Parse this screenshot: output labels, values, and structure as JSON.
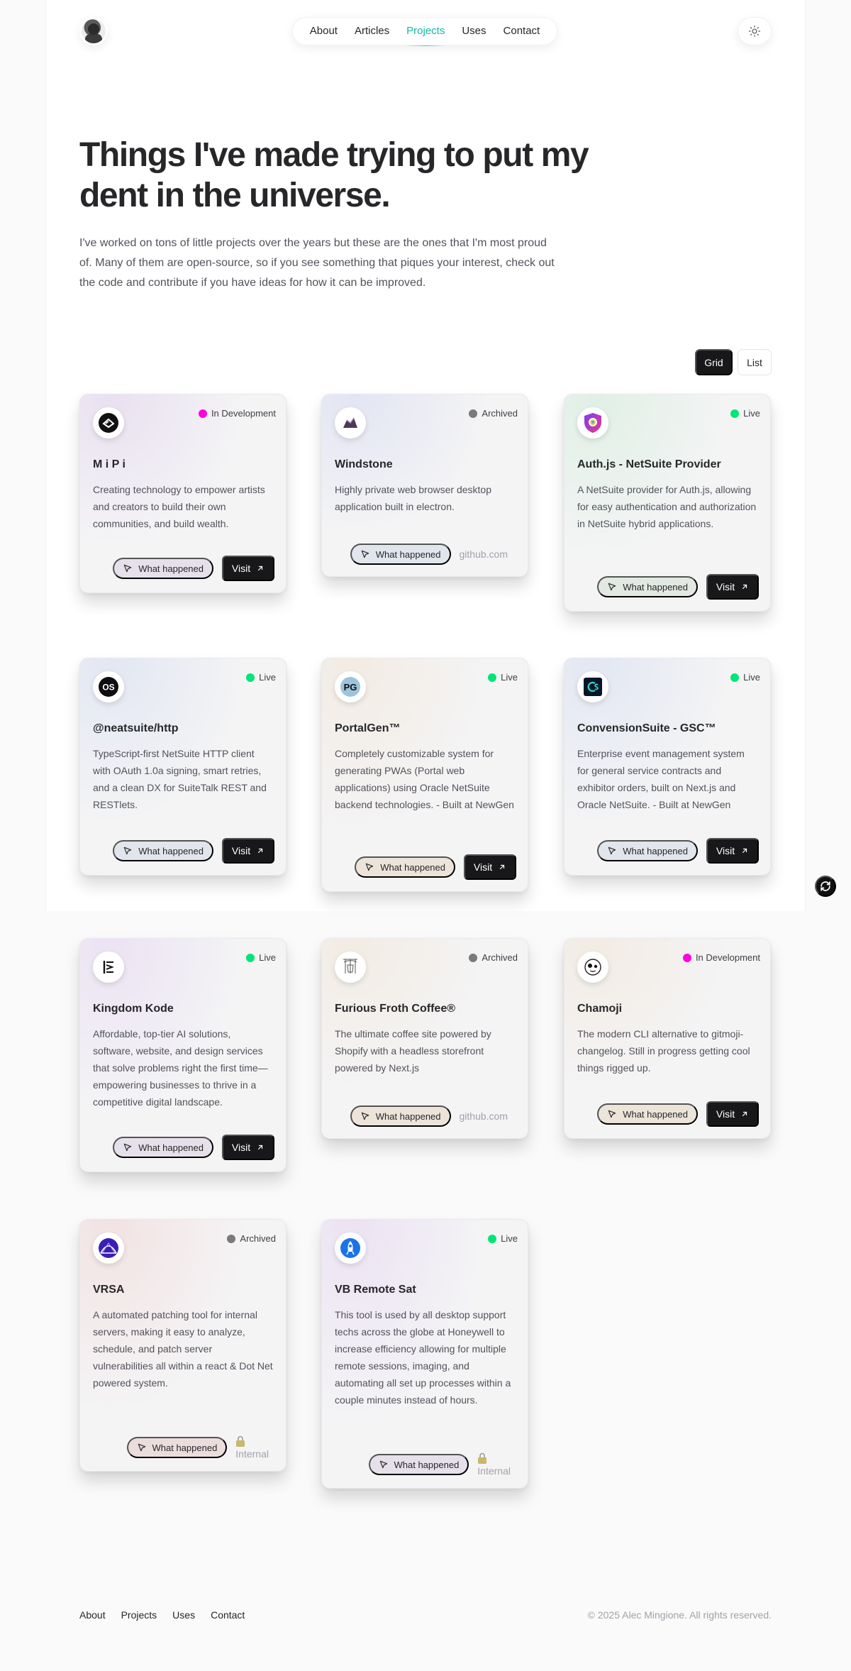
{
  "header": {
    "nav": [
      "About",
      "Articles",
      "Projects",
      "Uses",
      "Contact"
    ],
    "active_nav": "Projects"
  },
  "hero": {
    "title": "Things I've made trying to put my dent in the universe.",
    "subtitle": "I've worked on tons of little projects over the years but these are the ones that I'm most proud of. Many of them are open-source, so if you see something that piques your interest, check out the code and contribute if you have ideas for how it can be improved."
  },
  "view_toggle": {
    "grid": "Grid",
    "list": "List",
    "selected": "Grid"
  },
  "common": {
    "what_happened": "What happened",
    "visit": "Visit"
  },
  "colors": {
    "accent": "#14b8a6",
    "live": "#00e676",
    "archived": "#7a7a7a",
    "in_development": "#ff00e0"
  },
  "projects": [
    {
      "title": "M i P i",
      "status": "In Development",
      "description": "Creating technology to empower artists and creators to build their own communities, and build wealth.",
      "action": "visit",
      "logo_icon": "mipi-logo-icon"
    },
    {
      "title": "Windstone",
      "status": "Archived",
      "description": "Highly private web browser desktop application built in electron.",
      "action": "github",
      "action_label": "github.com",
      "logo_icon": "windstone-logo-icon"
    },
    {
      "title": "Auth.js - NetSuite Provider",
      "status": "Live",
      "description": "A NetSuite provider for Auth.js, allowing for easy authentication and authorization in NetSuite hybrid applications.",
      "action": "visit",
      "logo_icon": "authjs-shield-icon"
    },
    {
      "title": "@neatsuite/http",
      "status": "Live",
      "description": "TypeScript-first NetSuite HTTP client with OAuth 1.0a signing, smart retries, and a clean DX for SuiteTalk REST and RESTlets.",
      "action": "visit",
      "logo_icon": "os-logo-icon",
      "logo_text": "OS"
    },
    {
      "title": "PortalGen™",
      "status": "Live",
      "description": "Completely customizable system for generating PWAs (Portal web applications) using Oracle NetSuite backend technologies. - Built at NewGen",
      "action": "visit",
      "logo_icon": "pg-logo-icon",
      "logo_text": "PG"
    },
    {
      "title": "ConvensionSuite - GSC™",
      "status": "Live",
      "description": "Enterprise event management system for general service contracts and exhibitor orders, built on Next.js and Oracle NetSuite. - Built at NewGen",
      "action": "visit",
      "logo_icon": "cs-logo-icon"
    },
    {
      "title": "Kingdom Kode",
      "status": "Live",
      "description": "Affordable, top-tier AI solutions, software, website, and design services that solve problems right the first time—empowering businesses to thrive in a competitive digital landscape.",
      "action": "visit",
      "logo_icon": "kingdom-kode-logo-icon"
    },
    {
      "title": "Furious Froth Coffee®",
      "status": "Archived",
      "description": "The ultimate coffee site powered by Shopify with a headless storefront powered by Next.js",
      "action": "github",
      "action_label": "github.com",
      "logo_icon": "coffee-logo-icon"
    },
    {
      "title": "Chamoji",
      "status": "In Development",
      "description": "The modern CLI alternative to gitmoji-changelog. Still in progress getting cool things rigged up.",
      "action": "visit",
      "logo_icon": "chamoji-logo-icon"
    },
    {
      "title": "VRSA",
      "status": "Archived",
      "description": "A automated patching tool for internal servers, making it easy to analyze, schedule, and patch server vulnerabilities all within a react & Dot Net powered system.",
      "action": "internal",
      "action_label": "Internal",
      "logo_icon": "vrsa-logo-icon"
    },
    {
      "title": "VB Remote Sat",
      "status": "Live",
      "description": "This tool is used by all desktop support techs across the globe at Honeywell to increase efficiency allowing for multiple remote sessions, imaging, and automating all set up processes within a couple minutes instead of hours.",
      "action": "internal",
      "action_label": "Internal",
      "logo_icon": "rocket-logo-icon"
    }
  ],
  "footer": {
    "links": [
      "About",
      "Projects",
      "Uses",
      "Contact"
    ],
    "copyright": "© 2025 Alec Mingione. All rights reserved."
  }
}
